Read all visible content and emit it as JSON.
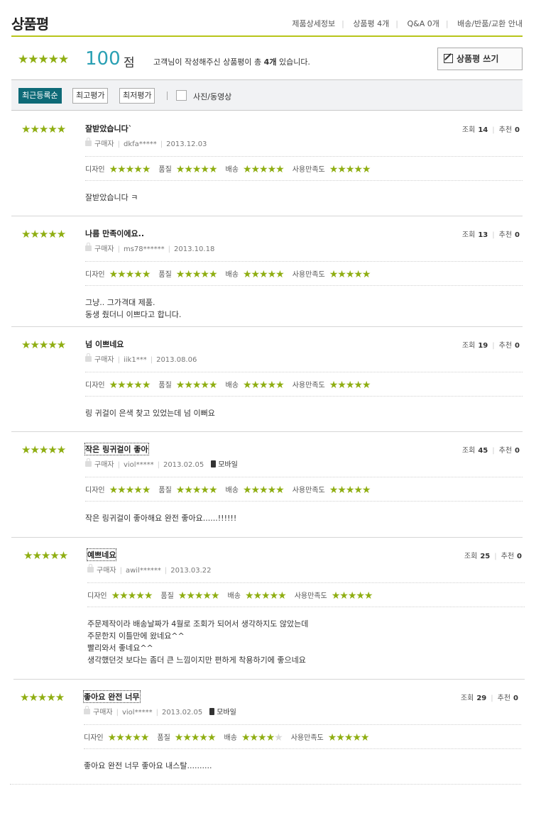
{
  "header": {
    "title": "상품평",
    "nav": [
      "제품상세정보",
      "상품평 4개",
      "Q&A 0개",
      "배송/반품/교환 안내"
    ]
  },
  "summary": {
    "rating": 5,
    "score": "100",
    "score_unit": "점",
    "desc_prefix": "고객님이 작성해주신 상품평이 총",
    "desc_count": "4개",
    "desc_suffix": "있습니다.",
    "write_label": "상품평 쓰기"
  },
  "filters": {
    "buttons": [
      "최근등록순",
      "최고평가",
      "최저평가"
    ],
    "active": 0,
    "checkbox_label": "사진/동영상"
  },
  "score_labels": [
    "디자인",
    "품질",
    "배송",
    "사용만족도"
  ],
  "stat_labels": {
    "views": "조회",
    "recommend": "추천"
  },
  "colors": {
    "accent": "#8fae12",
    "score": "#2aa0b4",
    "active_filter": "#0e6a77",
    "header_line": "#b8c51a"
  },
  "reviews": [
    {
      "rating": 5,
      "title": "잘받았습니다`",
      "dotted": false,
      "type": "구매자",
      "user": "dkfa*****",
      "date": "2013.12.03",
      "mobile": false,
      "views": "14",
      "recommend": "0",
      "scores": [
        5,
        5,
        5,
        5
      ],
      "body": [
        "잘받았습니다 ㅋ"
      ]
    },
    {
      "rating": 5,
      "title": "나름 만족이에요..",
      "dotted": false,
      "type": "구매자",
      "user": "ms78******",
      "date": "2013.10.18",
      "mobile": false,
      "views": "13",
      "recommend": "0",
      "scores": [
        5,
        5,
        5,
        5
      ],
      "body": [
        "그냥.. 그가격대 제품.",
        "동생 줬더니 이쁘다고 합니다."
      ]
    },
    {
      "rating": 5,
      "title": "넘 이쁘네요",
      "dotted": false,
      "type": "구매자",
      "user": "iik1***",
      "date": "2013.08.06",
      "mobile": false,
      "views": "19",
      "recommend": "0",
      "scores": [
        5,
        5,
        5,
        5
      ],
      "body": [
        "링 귀걸이 은색 찾고 있었는데 넘 이뻐요"
      ]
    },
    {
      "rating": 5,
      "title": "작은 링귀걸이 좋아",
      "dotted": true,
      "type": "구매자",
      "user": "viol*****",
      "date": "2013.02.05",
      "mobile": true,
      "views": "45",
      "recommend": "0",
      "scores": [
        5,
        5,
        5,
        5
      ],
      "body": [
        "작은 링귀걸이 좋아해요 완전 좋아요......!!!!!!"
      ]
    },
    {
      "rating": 5,
      "title": "예쁘네요",
      "dotted": true,
      "type": "구매자",
      "user": "awil******",
      "date": "2013.03.22",
      "mobile": false,
      "views": "25",
      "recommend": "0",
      "scores": [
        5,
        5,
        5,
        5
      ],
      "body": [
        "주문제작이라 배송날짜가 4월로 조회가 되어서 생각하지도 않았는데",
        "주문한지 이틀만에 왔네요^^",
        "빨리와서 좋네요^^",
        "생각했던것 보다는 좀더 큰 느낌이지만 편하게 착용하기에 좋으네요"
      ]
    },
    {
      "rating": 5,
      "title": "좋아요 완전 너무",
      "dotted": true,
      "type": "구매자",
      "user": "viol*****",
      "date": "2013.02.05",
      "mobile": true,
      "views": "29",
      "recommend": "0",
      "scores": [
        5,
        5,
        4,
        5
      ],
      "body": [
        "좋아요 완전 너무 좋아요 내스탈.........."
      ]
    }
  ],
  "mobile_label": "모바일"
}
